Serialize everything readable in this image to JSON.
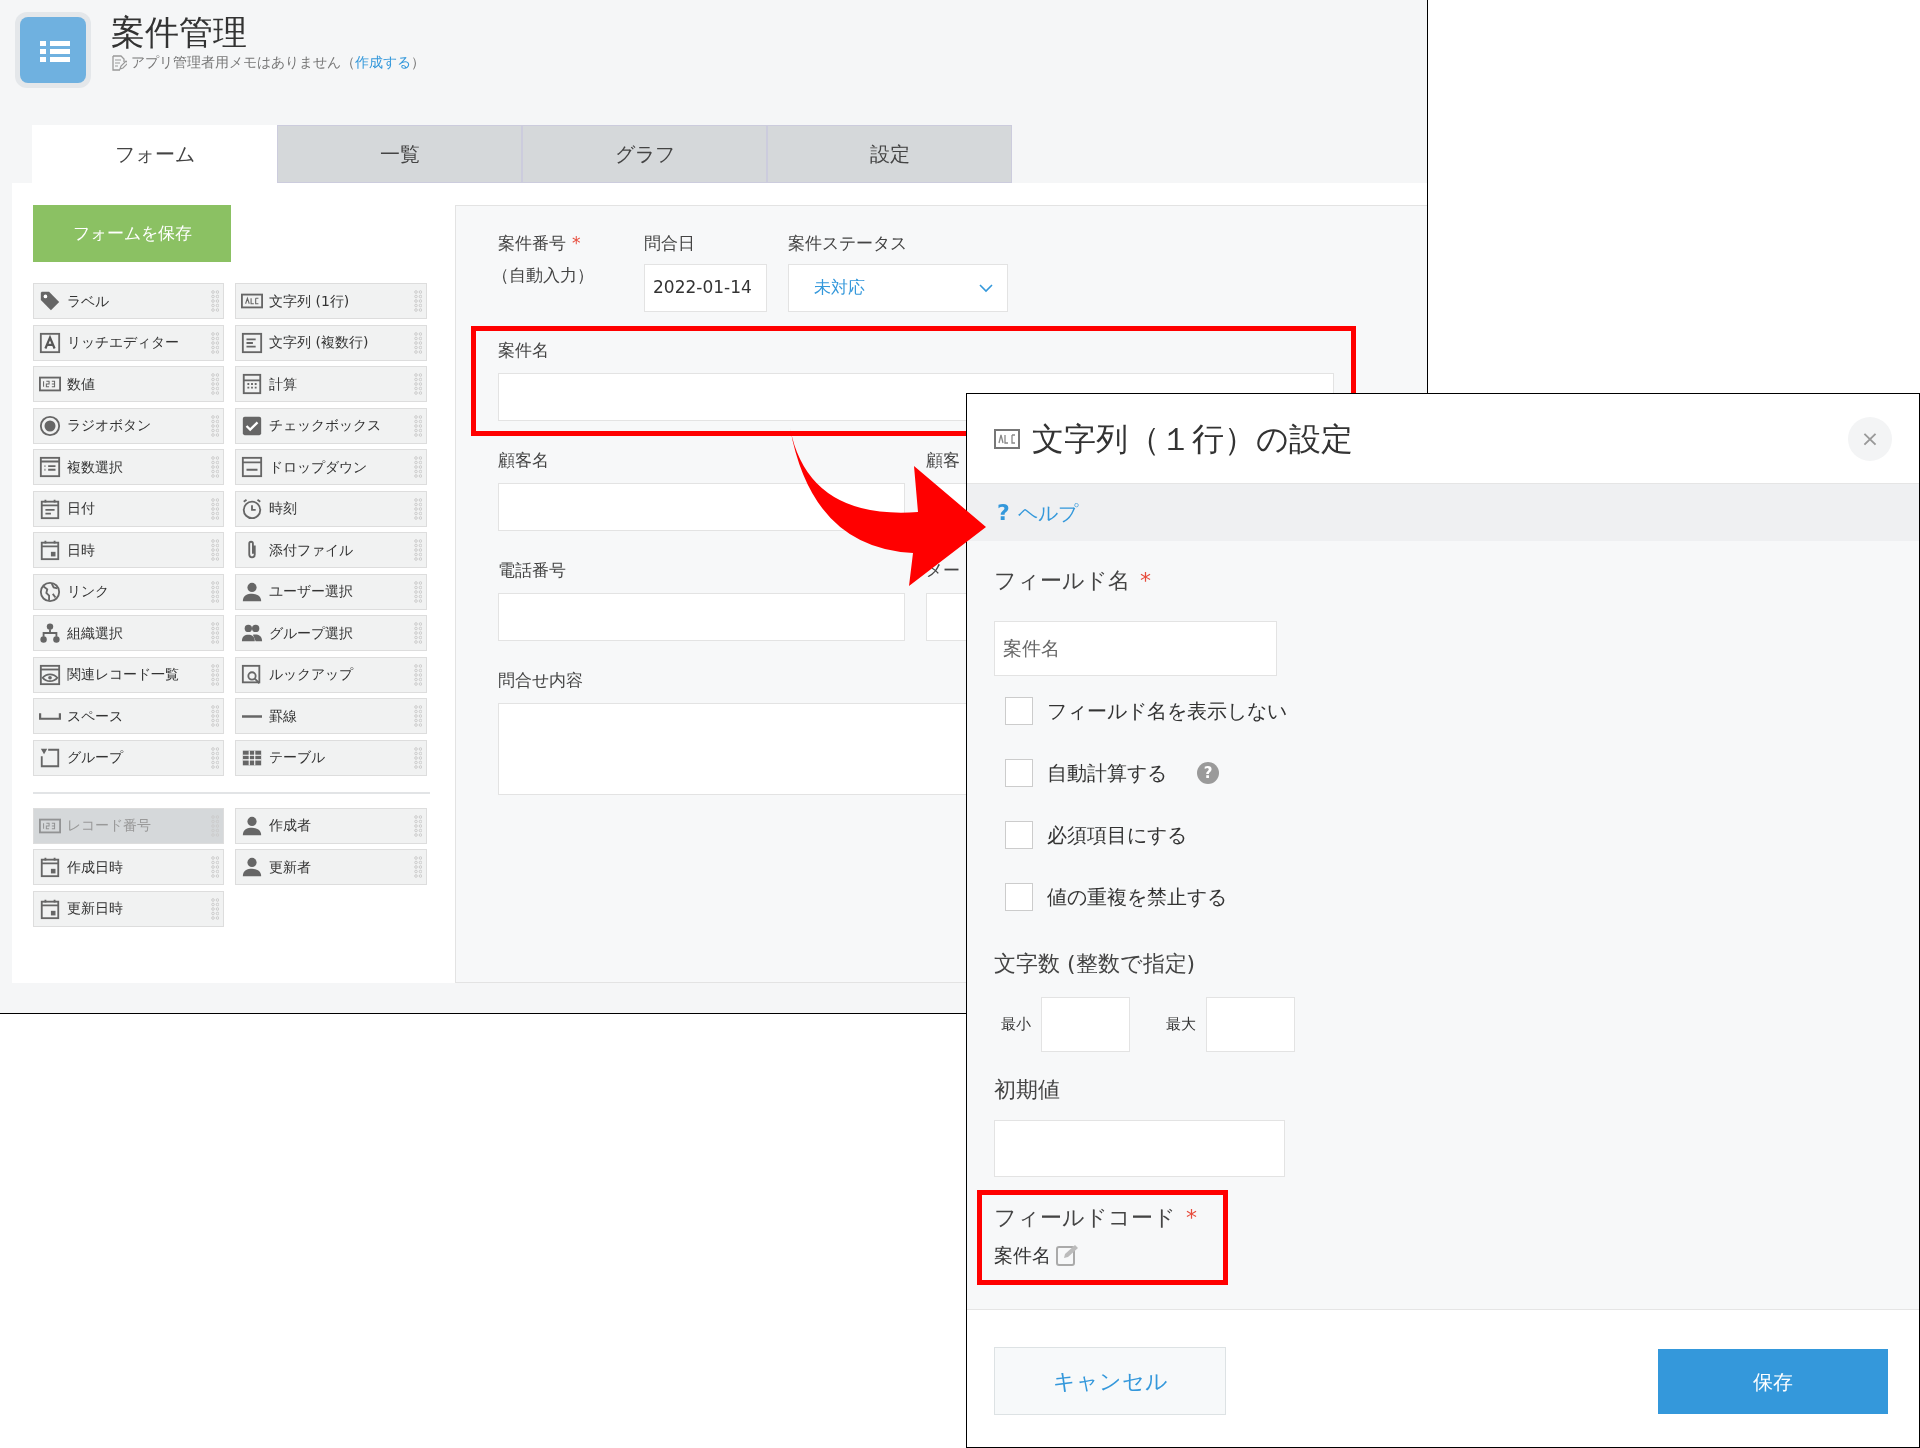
{
  "app": {
    "title": "案件管理",
    "memo": {
      "before": "アプリ管理者用メモはありません（",
      "link": "作成する",
      "after": "）"
    }
  },
  "tabs": [
    {
      "label": "フォーム",
      "selected": true
    },
    {
      "label": "一覧",
      "selected": false
    },
    {
      "label": "グラフ",
      "selected": false
    },
    {
      "label": "設定",
      "selected": false
    }
  ],
  "palette": {
    "save_button": "フォームを保存",
    "items": [
      {
        "label": "ラベル",
        "kind": "tag"
      },
      {
        "label": "文字列 (1行)",
        "kind": "abc"
      },
      {
        "label": "リッチエディター",
        "kind": "rich"
      },
      {
        "label": "文字列 (複数行)",
        "kind": "multiline"
      },
      {
        "label": "数値",
        "kind": "number"
      },
      {
        "label": "計算",
        "kind": "calc"
      },
      {
        "label": "ラジオボタン",
        "kind": "radio"
      },
      {
        "label": "チェックボックス",
        "kind": "checkbox"
      },
      {
        "label": "複数選択",
        "kind": "multiselect"
      },
      {
        "label": "ドロップダウン",
        "kind": "dropdown"
      },
      {
        "label": "日付",
        "kind": "date"
      },
      {
        "label": "時刻",
        "kind": "time"
      },
      {
        "label": "日時",
        "kind": "datetime"
      },
      {
        "label": "添付ファイル",
        "kind": "attachment"
      },
      {
        "label": "リンク",
        "kind": "link"
      },
      {
        "label": "ユーザー選択",
        "kind": "user"
      },
      {
        "label": "組織選択",
        "kind": "org"
      },
      {
        "label": "グループ選択",
        "kind": "people"
      },
      {
        "label": "関連レコード一覧",
        "kind": "related"
      },
      {
        "label": "ルックアップ",
        "kind": "lookup"
      },
      {
        "label": "スペース",
        "kind": "space"
      },
      {
        "label": "罫線",
        "kind": "line"
      },
      {
        "label": "グループ",
        "kind": "group"
      },
      {
        "label": "テーブル",
        "kind": "table"
      }
    ],
    "system_items": [
      {
        "label": "レコード番号",
        "kind": "number",
        "disabled": true
      },
      {
        "label": "作成者",
        "kind": "user",
        "disabled": false
      },
      {
        "label": "作成日時",
        "kind": "datetime",
        "disabled": false
      },
      {
        "label": "更新者",
        "kind": "user",
        "disabled": false
      },
      {
        "label": "更新日時",
        "kind": "datetime",
        "disabled": false
      }
    ]
  },
  "form": {
    "header_fields": [
      {
        "label": "案件番号",
        "required_mark": "*",
        "note": "（自動入力）",
        "kind": "auto"
      },
      {
        "label": "問合日",
        "value": "2022-01-14",
        "kind": "date"
      },
      {
        "label": "案件ステータス",
        "value": "未対応",
        "kind": "dropdown"
      }
    ],
    "rows": [
      {
        "highlighted": true,
        "fields": [
          {
            "label": "案件名",
            "kind": "wide"
          }
        ]
      },
      {
        "highlighted": false,
        "fields": [
          {
            "label": "顧客名",
            "kind": "text"
          },
          {
            "label": "顧客",
            "kind": "text"
          }
        ]
      },
      {
        "highlighted": false,
        "fields": [
          {
            "label": "電話番号",
            "kind": "text"
          },
          {
            "label": "メー",
            "kind": "text"
          }
        ]
      },
      {
        "highlighted": false,
        "fields": [
          {
            "label": "問合せ内容",
            "kind": "textarea"
          }
        ]
      }
    ]
  },
  "dialog": {
    "title": "文字列（１行）の設定",
    "close": "×",
    "help": {
      "glyph": "?",
      "label": "ヘルプ"
    },
    "field_name": {
      "label": "フィールド名",
      "required_mark": "*",
      "value": "案件名"
    },
    "options": [
      {
        "label": "フィールド名を表示しない",
        "checked": false
      },
      {
        "label": "自動計算する",
        "checked": false,
        "help_glyph": "?"
      },
      {
        "label": "必須項目にする",
        "checked": false
      },
      {
        "label": "値の重複を禁止する",
        "checked": false
      }
    ],
    "length": {
      "label": "文字数 (整数で指定)",
      "min_label": "最小",
      "max_label": "最大"
    },
    "default_value": {
      "label": "初期値"
    },
    "field_code": {
      "label": "フィールドコード",
      "required_mark": "*",
      "value": "案件名",
      "highlighted": true
    },
    "buttons": {
      "cancel": "キャンセル",
      "save": "保存"
    }
  }
}
